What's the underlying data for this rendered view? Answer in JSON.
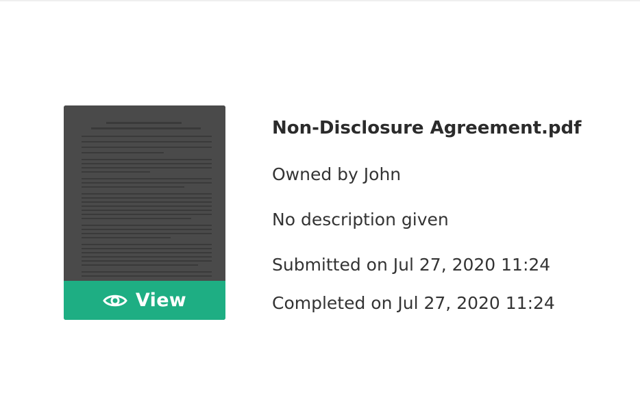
{
  "document": {
    "title": "Non-Disclosure Agreement.pdf",
    "owner": "Owned by John",
    "description": "No description given",
    "submitted": "Submitted on Jul 27, 2020 11:24",
    "completed": "Completed on Jul 27, 2020 11:24"
  },
  "thumbnail": {
    "view_label": "View",
    "view_icon": "eye-icon"
  },
  "colors": {
    "accent": "#1eae83",
    "overlay": "#474747",
    "text": "#2b2b2b"
  }
}
